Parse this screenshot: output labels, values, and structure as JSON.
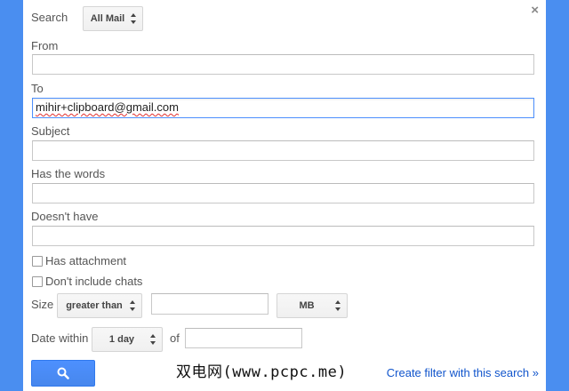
{
  "search": {
    "label": "Search",
    "scope": "All Mail"
  },
  "close_glyph": "×",
  "from": {
    "label": "From",
    "value": ""
  },
  "to": {
    "label": "To",
    "value": "mihir+clipboard@gmail.com"
  },
  "subject": {
    "label": "Subject",
    "value": ""
  },
  "has_words": {
    "label": "Has the words",
    "value": ""
  },
  "doesnt_have": {
    "label": "Doesn't have",
    "value": ""
  },
  "has_attachment": {
    "label": "Has attachment",
    "checked": false
  },
  "dont_include_chats": {
    "label": "Don't include chats",
    "checked": false
  },
  "size": {
    "label": "Size",
    "operator": "greater than",
    "value": "",
    "unit": "MB"
  },
  "date_within": {
    "label": "Date within",
    "range": "1 day",
    "of_label": "of",
    "value": ""
  },
  "search_button": {
    "icon": "search-icon"
  },
  "create_filter": {
    "label": "Create filter with this search »"
  },
  "watermark": "双电网(www.pcpc.me)",
  "colors": {
    "accent": "#4d90fe",
    "link": "#1155cc",
    "background": "#4a8ef0"
  }
}
